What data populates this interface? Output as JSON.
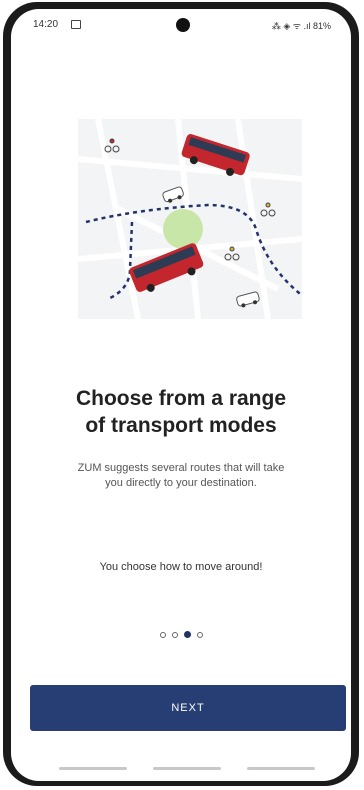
{
  "status_bar": {
    "time": "14:20",
    "right_icons": "⁂ ◈ ᯤ .ıl 81%"
  },
  "onboarding": {
    "title_line1": "Choose from a range",
    "title_line2": "of transport modes",
    "subtitle": "ZUM suggests several routes that will take you directly to your destination.",
    "tagline": "You choose how to move around!",
    "page_indicator": {
      "current": 3,
      "total": 4
    },
    "next_label": "NEXT"
  },
  "colors": {
    "primary": "#263e74",
    "bus_red": "#c4262e",
    "map_green": "#c8e6a8"
  },
  "icons": [
    "image-icon",
    "camera-icon",
    "wifi-icon",
    "signal-icon",
    "battery-icon",
    "bus-icon",
    "car-icon",
    "cyclist-icon"
  ]
}
